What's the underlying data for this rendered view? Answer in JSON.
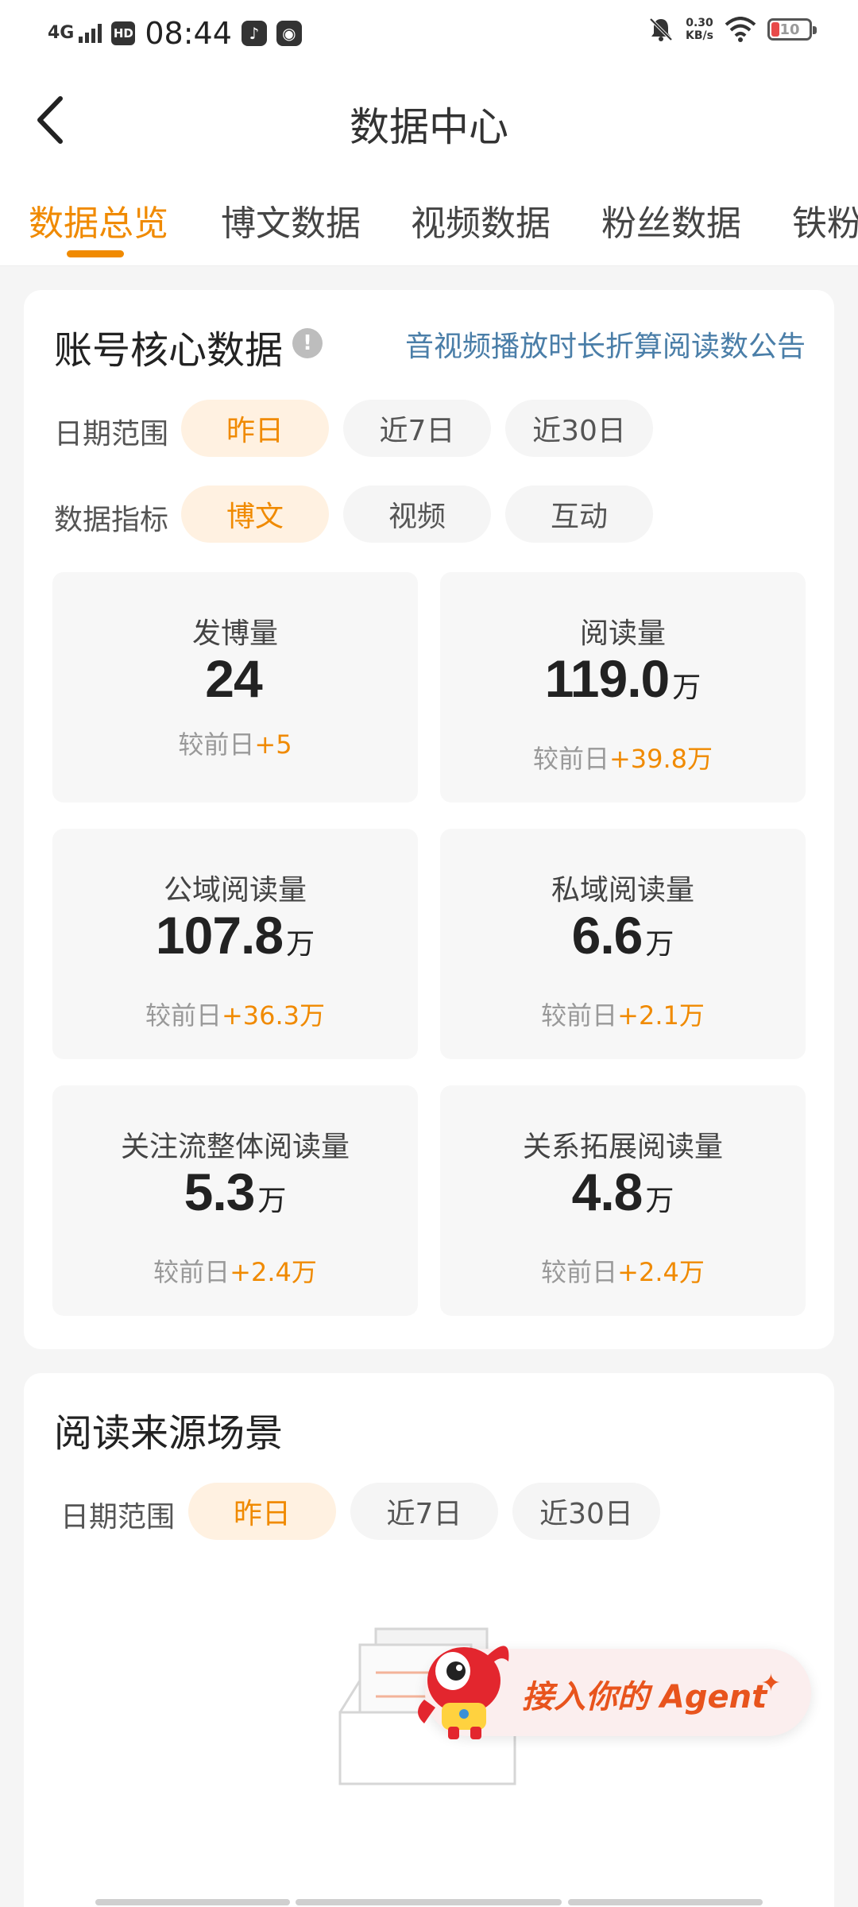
{
  "status_bar": {
    "network": "4G",
    "hd": "HD",
    "time": "08:44",
    "speed_value": "0.30",
    "speed_unit": "KB/s",
    "battery": "10"
  },
  "header": {
    "title": "数据中心"
  },
  "tabs": [
    {
      "label": "数据总览",
      "active": true
    },
    {
      "label": "博文数据",
      "active": false
    },
    {
      "label": "视频数据",
      "active": false
    },
    {
      "label": "粉丝数据",
      "active": false
    },
    {
      "label": "铁粉",
      "active": false
    }
  ],
  "core_data": {
    "title": "账号核心数据",
    "info_icon": "!",
    "notice_link": "音视频播放时长折算阅读数公告",
    "date_range": {
      "label": "日期范围",
      "options": [
        "昨日",
        "近7日",
        "近30日"
      ],
      "selected": "昨日"
    },
    "metric": {
      "label": "数据指标",
      "options": [
        "博文",
        "视频",
        "互动"
      ],
      "selected": "博文"
    },
    "stats": [
      {
        "label": "发博量",
        "value": "24",
        "unit": "",
        "delta_prefix": "较前日",
        "delta": "+5"
      },
      {
        "label": "阅读量",
        "value": "119.0",
        "unit": "万",
        "delta_prefix": "较前日",
        "delta": "+39.8万"
      },
      {
        "label": "公域阅读量",
        "value": "107.8",
        "unit": "万",
        "delta_prefix": "较前日",
        "delta": "+36.3万"
      },
      {
        "label": "私域阅读量",
        "value": "6.6",
        "unit": "万",
        "delta_prefix": "较前日",
        "delta": "+2.1万"
      },
      {
        "label": "关注流整体阅读量",
        "value": "5.3",
        "unit": "万",
        "delta_prefix": "较前日",
        "delta": "+2.4万"
      },
      {
        "label": "关系拓展阅读量",
        "value": "4.8",
        "unit": "万",
        "delta_prefix": "较前日",
        "delta": "+2.4万"
      }
    ]
  },
  "read_source": {
    "title": "阅读来源场景",
    "date_range": {
      "label": "日期范围",
      "options": [
        "昨日",
        "近7日",
        "近30日"
      ],
      "selected": "昨日"
    }
  },
  "agent_banner": {
    "text": "接入你的 Agent",
    "sparkle": "✦"
  },
  "colors": {
    "accent": "#f08a00",
    "link": "#4a7ea8",
    "banner_text": "#e8541d"
  }
}
